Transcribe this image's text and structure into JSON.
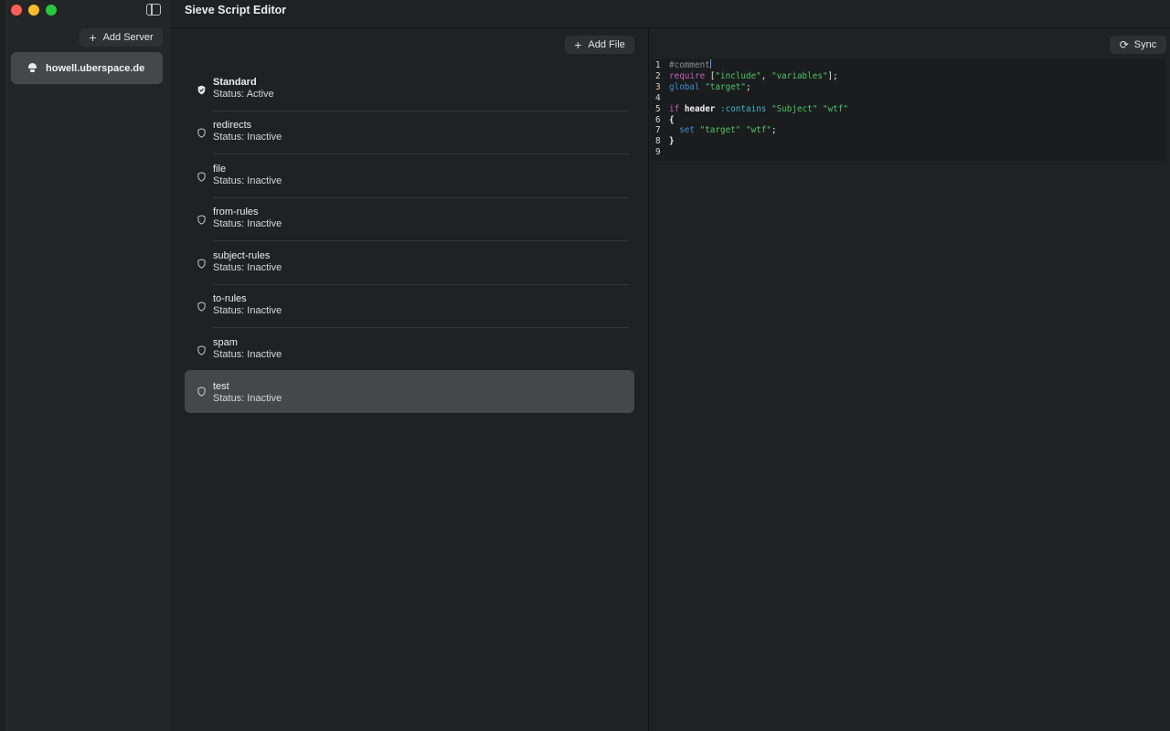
{
  "window": {
    "title": "Sieve Script Editor"
  },
  "sidebar": {
    "add_server_label": "Add Server",
    "servers": [
      {
        "name": "howell.uberspace.de",
        "selected": true
      }
    ]
  },
  "files_panel": {
    "add_file_label": "Add File",
    "files": [
      {
        "name": "Standard",
        "status": "Status: Active"
      },
      {
        "name": "redirects",
        "status": "Status: Inactive"
      },
      {
        "name": "file",
        "status": "Status: Inactive"
      },
      {
        "name": "from-rules",
        "status": "Status: Inactive"
      },
      {
        "name": "subject-rules",
        "status": "Status: Inactive"
      },
      {
        "name": "to-rules",
        "status": "Status: Inactive"
      },
      {
        "name": "spam",
        "status": "Status: Inactive"
      },
      {
        "name": "test",
        "status": "Status: Inactive"
      }
    ],
    "selected_file": "test"
  },
  "editor": {
    "sync_label": "Sync",
    "line_numbers": [
      "1",
      "2",
      "3",
      "4",
      "5",
      "6",
      "7",
      "8",
      "9"
    ],
    "lines": [
      "#comment",
      "require [\"include\", \"variables\"];",
      "global \"target\";",
      "",
      "if header :contains \"Subject\" \"wtf\"",
      "{",
      "  set \"target\" \"wtf\";",
      "}",
      ""
    ]
  },
  "colors": {
    "background": "#1f2123",
    "selection": "#454749",
    "keyword": "#c45ec7",
    "string": "#4ec46a",
    "tag": "#3bb6c9",
    "comment": "#8a8d91"
  }
}
